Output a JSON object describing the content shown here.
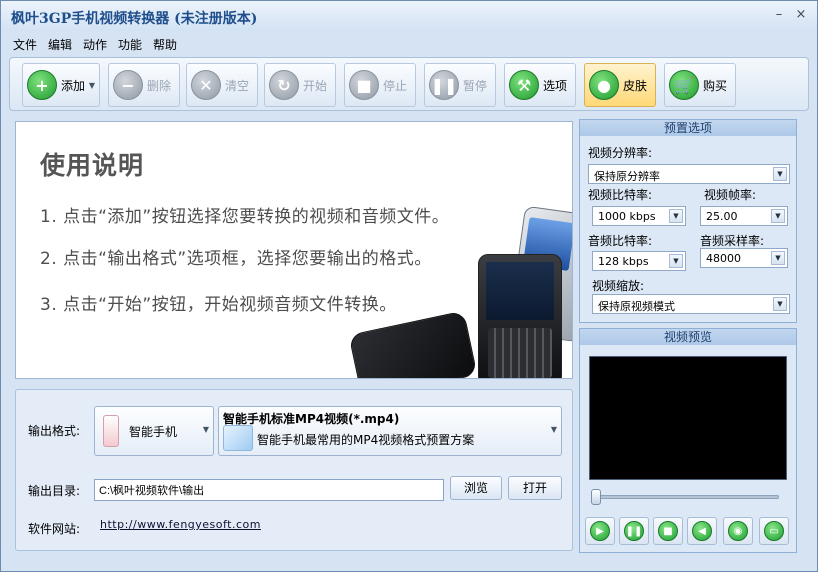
{
  "window": {
    "title": "枫叶3GP手机视频转换器  (未注册版本)",
    "minimize_glyph": "–",
    "close_glyph": "×"
  },
  "menu": [
    "文件",
    "编辑",
    "动作",
    "功能",
    "帮助"
  ],
  "toolbar": {
    "add": "添加",
    "delete": "删除",
    "clear": "清空",
    "start": "开始",
    "stop": "停止",
    "pause": "暂停",
    "options": "选项",
    "skin": "皮肤",
    "buy": "购买"
  },
  "guide": {
    "title": "使用说明",
    "steps": [
      "1. 点击“添加”按钮选择您要转换的视频和音频文件。",
      "2. 点击“输出格式”选项框，选择您要输出的格式。",
      "3. 点击“开始”按钮，开始视频音频文件转换。"
    ]
  },
  "output": {
    "format_label": "输出格式:",
    "device": "智能手机",
    "format_name": "智能手机标准MP4视频(*.mp4)",
    "format_desc": "智能手机最常用的MP4视频格式预置方案",
    "dir_label": "输出目录:",
    "dir_value": "C:\\枫叶视频软件\\输出",
    "browse": "浏览",
    "open": "打开",
    "site_label": "软件网站:",
    "site_url": "http://www.fengyesoft.com"
  },
  "preset": {
    "heading": "预置选项",
    "resolution_label": "视频分辨率:",
    "resolution_value": "保持原分辨率",
    "vbitrate_label": "视频比特率:",
    "vbitrate_value": "1000 kbps",
    "framerate_label": "视频帧率:",
    "framerate_value": "25.00",
    "abitrate_label": "音频比特率:",
    "abitrate_value": "128 kbps",
    "samplerate_label": "音频采样率:",
    "samplerate_value": "48000",
    "scale_label": "视频缩放:",
    "scale_value": "保持原视频模式"
  },
  "preview": {
    "heading": "视频预览",
    "controls": [
      "play-icon",
      "pause-icon",
      "stop-icon",
      "volume-icon",
      "snapshot-icon",
      "folder-icon"
    ]
  },
  "colors": {
    "accent_green": "#1e9a2e",
    "title_blue": "#1e4e8c",
    "panel_blue": "#d6e3f3"
  }
}
